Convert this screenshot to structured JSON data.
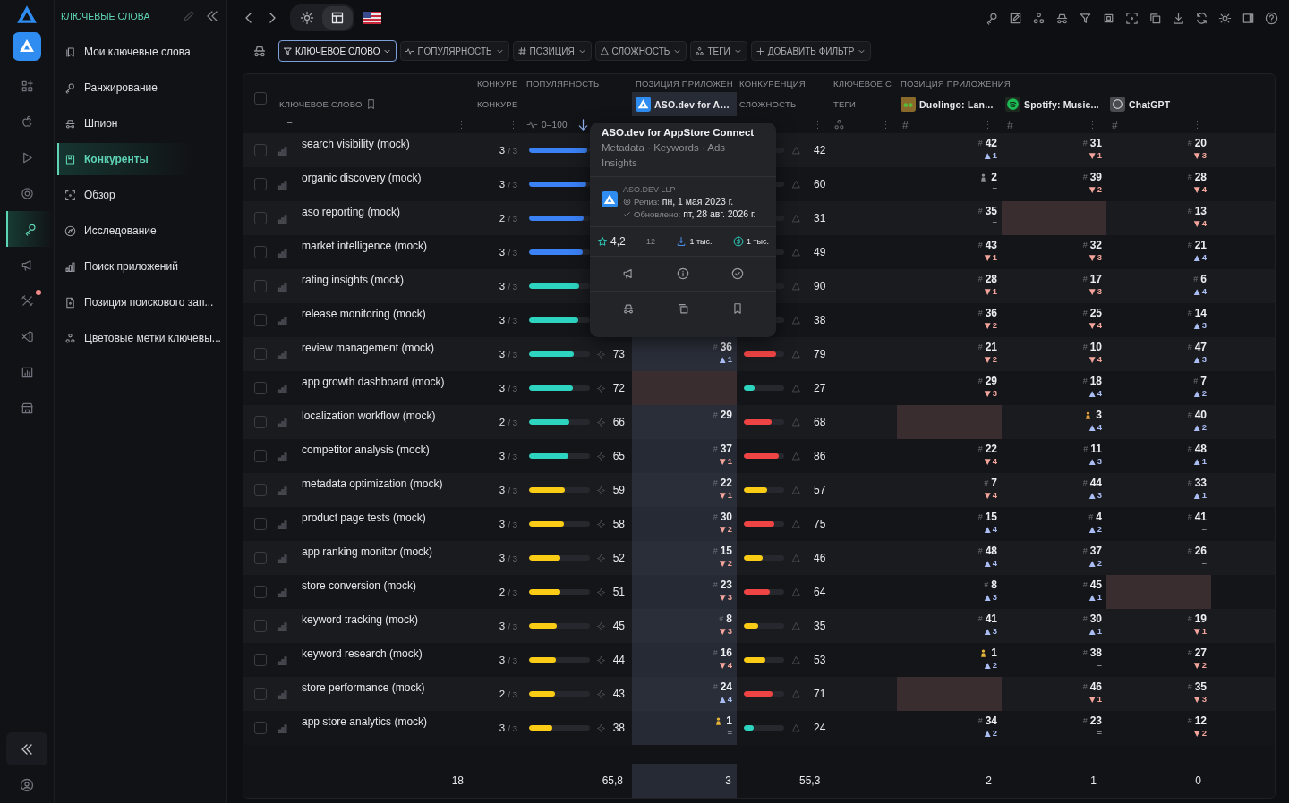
{
  "rail": [
    {
      "selected": false,
      "badge": false
    },
    {
      "selected": false,
      "badge": false
    },
    {
      "selected": false,
      "badge": false
    },
    {
      "selected": false,
      "badge": false
    },
    {
      "selected": true,
      "badge": false
    },
    {
      "selected": false,
      "badge": false
    },
    {
      "selected": false,
      "badge": true
    },
    {
      "selected": false,
      "badge": false
    },
    {
      "selected": false,
      "badge": false
    },
    {
      "selected": false,
      "badge": false
    }
  ],
  "sidebar": {
    "title": "КЛЮЧЕВЫЕ СЛОВА",
    "items": [
      {
        "label": "Мои ключевые слова",
        "selected": false
      },
      {
        "label": "Ранжирование",
        "selected": false
      },
      {
        "label": "Шпион",
        "selected": false
      },
      {
        "label": "Конкуренты",
        "selected": true
      },
      {
        "label": "Обзор",
        "selected": false
      },
      {
        "label": "Исследование",
        "selected": false
      },
      {
        "label": "Поиск приложений",
        "selected": false
      },
      {
        "label": "Позиция поискового зап...",
        "selected": false
      },
      {
        "label": "Цветовые метки ключевы...",
        "selected": false
      }
    ]
  },
  "view_modes": [
    {
      "selected": false
    },
    {
      "selected": true
    }
  ],
  "filters": [
    {
      "label": "КЛЮЧЕВОЕ СЛОВО",
      "selected": true
    },
    {
      "label": "ПОПУЛЯРНОСТЬ",
      "selected": false
    },
    {
      "label": "ПОЗИЦИЯ",
      "selected": false
    },
    {
      "label": "СЛОЖНОСТЬ",
      "selected": false
    },
    {
      "label": "ТЕГИ",
      "selected": false
    },
    {
      "label": "ДОБАВИТЬ ФИЛЬТР",
      "selected": false
    }
  ],
  "table": {
    "select_all": {
      "checked": false
    },
    "headers": {
      "keyword_title": "КЛЮЧЕВОЕ СЛОВО",
      "keyword_sub": "–",
      "competitors_title": "КОНКУРЕ",
      "competitors_sub": "КОНКУРЕ",
      "popularity_title": "ПОПУЛЯРНОСТЬ",
      "popularity_range": "0–100",
      "own_title": "ПОЗИЦИЯ ПРИЛОЖЕН",
      "own_app": "ASO.dev for A…",
      "competition_title": "КОНКУРЕНЦИЯ",
      "difficulty_sub": "СЛОЖНОСТЬ",
      "tags_title": "КЛЮЧЕВОЕ С",
      "tags_sub": "ТЕГИ",
      "apps_title": "ПОЗИЦИЯ ПРИЛОЖЕНИЯ",
      "apps": [
        {
          "name": "Duolingo: Lan...",
          "mark": "#"
        },
        {
          "name": "Spotify: Music...",
          "mark": "#"
        },
        {
          "name": "ChatGPT",
          "mark": "#"
        }
      ]
    },
    "rows": [
      {
        "keyword": "search visibility (mock)",
        "checked": false,
        "count": "3",
        "total": "/ 3",
        "popularity": {
          "level": 0.95,
          "color": "#3b82f6"
        },
        "difficulty": {
          "value": "42"
        },
        "apps": [
          {
            "kind": "rank",
            "mark": "#",
            "rank": "42",
            "arrow": "▲",
            "change": "1",
            "color": "#a9bdf3"
          },
          {
            "kind": "rank",
            "mark": "#",
            "rank": "31",
            "arrow": "▼",
            "change": "1",
            "color": "#f3a59c"
          },
          {
            "kind": "rank",
            "mark": "#",
            "rank": "20",
            "arrow": "▼",
            "change": "3",
            "color": "#f3a59c"
          }
        ]
      },
      {
        "keyword": "organic discovery (mock)",
        "checked": false,
        "count": "3",
        "total": "/ 3",
        "popularity": {
          "level": 0.94,
          "color": "#3b82f6"
        },
        "difficulty": {
          "value": "60"
        },
        "apps": [
          {
            "kind": "rank",
            "medal": {
              "color": "#8b8d93"
            },
            "rank": "2",
            "change": "=",
            "color": "#80828a"
          },
          {
            "kind": "rank",
            "mark": "#",
            "rank": "39",
            "arrow": "▼",
            "change": "2",
            "color": "#f3a59c"
          },
          {
            "kind": "rank",
            "mark": "#",
            "rank": "28",
            "arrow": "▼",
            "change": "4",
            "color": "#f3a59c"
          }
        ]
      },
      {
        "keyword": "aso reporting (mock)",
        "checked": false,
        "count": "2",
        "total": "/ 3",
        "popularity": {
          "level": 0.9,
          "color": "#3b82f6"
        },
        "difficulty": {
          "value": "31"
        },
        "apps": [
          {
            "kind": "rank",
            "mark": "#",
            "rank": "35",
            "change": "=",
            "color": "#80828a"
          },
          {
            "kind": "empty"
          },
          {
            "kind": "rank",
            "mark": "#",
            "rank": "13",
            "arrow": "▼",
            "change": "4",
            "color": "#f3a59c"
          }
        ]
      },
      {
        "keyword": "market intelligence (mock)",
        "checked": false,
        "count": "3",
        "total": "/ 3",
        "popularity": {
          "level": 0.88,
          "color": "#3b82f6"
        },
        "difficulty": {
          "value": "49"
        },
        "apps": [
          {
            "kind": "rank",
            "mark": "#",
            "rank": "43",
            "arrow": "▼",
            "change": "1",
            "color": "#f3a59c"
          },
          {
            "kind": "rank",
            "mark": "#",
            "rank": "32",
            "arrow": "▼",
            "change": "3",
            "color": "#f3a59c"
          },
          {
            "kind": "rank",
            "mark": "#",
            "rank": "21",
            "arrow": "▲",
            "change": "4",
            "color": "#a9bdf3"
          }
        ]
      },
      {
        "keyword": "rating insights (mock)",
        "checked": false,
        "count": "3",
        "total": "/ 3",
        "popularity": {
          "level": 0.82,
          "color": "#2dd4bf"
        },
        "difficulty": {
          "value": "90"
        },
        "apps": [
          {
            "kind": "rank",
            "mark": "#",
            "rank": "28",
            "arrow": "▼",
            "change": "1",
            "color": "#f3a59c"
          },
          {
            "kind": "rank",
            "mark": "#",
            "rank": "17",
            "arrow": "▼",
            "change": "3",
            "color": "#f3a59c"
          },
          {
            "kind": "rank",
            "mark": "#",
            "rank": "6",
            "arrow": "▲",
            "change": "4",
            "color": "#a9bdf3"
          }
        ]
      },
      {
        "keyword": "release monitoring (mock)",
        "checked": false,
        "count": "3",
        "total": "/ 3",
        "popularity": {
          "level": 0.81,
          "color": "#2dd4bf"
        },
        "difficulty": {
          "value": "38"
        },
        "apps": [
          {
            "kind": "rank",
            "mark": "#",
            "rank": "36",
            "arrow": "▼",
            "change": "2",
            "color": "#f3a59c"
          },
          {
            "kind": "rank",
            "mark": "#",
            "rank": "25",
            "arrow": "▼",
            "change": "4",
            "color": "#f3a59c"
          },
          {
            "kind": "rank",
            "mark": "#",
            "rank": "14",
            "arrow": "▲",
            "change": "3",
            "color": "#a9bdf3"
          }
        ]
      },
      {
        "keyword": "review management (mock)",
        "checked": false,
        "count": "3",
        "total": "/ 3",
        "popularity": {
          "level": 0.73,
          "color": "#2dd4bf",
          "value": "73"
        },
        "own": {
          "kind": "rank",
          "mark": "#",
          "rank": "36",
          "arrow": "▲",
          "change": "1",
          "color": "#a9bdf3"
        },
        "difficulty": {
          "value": "79",
          "level": 0.79,
          "color": "#ef4444"
        },
        "apps": [
          {
            "kind": "rank",
            "mark": "#",
            "rank": "21",
            "arrow": "▼",
            "change": "2",
            "color": "#f3a59c"
          },
          {
            "kind": "rank",
            "mark": "#",
            "rank": "10",
            "arrow": "▼",
            "change": "4",
            "color": "#f3a59c"
          },
          {
            "kind": "rank",
            "mark": "#",
            "rank": "47",
            "arrow": "▲",
            "change": "3",
            "color": "#a9bdf3"
          }
        ]
      },
      {
        "keyword": "app growth dashboard (mock)",
        "checked": false,
        "count": "3",
        "total": "/ 3",
        "popularity": {
          "level": 0.72,
          "color": "#2dd4bf",
          "value": "72"
        },
        "own": {
          "kind": "empty"
        },
        "difficulty": {
          "value": "27",
          "level": 0.27,
          "color": "#2dd4bf"
        },
        "apps": [
          {
            "kind": "rank",
            "mark": "#",
            "rank": "29",
            "arrow": "▼",
            "change": "3",
            "color": "#f3a59c"
          },
          {
            "kind": "rank",
            "mark": "#",
            "rank": "18",
            "arrow": "▲",
            "change": "4",
            "color": "#a9bdf3"
          },
          {
            "kind": "rank",
            "mark": "#",
            "rank": "7",
            "arrow": "▲",
            "change": "2",
            "color": "#a9bdf3"
          }
        ]
      },
      {
        "keyword": "localization workflow (mock)",
        "checked": false,
        "count": "2",
        "total": "/ 3",
        "popularity": {
          "level": 0.66,
          "color": "#2dd4bf",
          "value": "66"
        },
        "own": {
          "kind": "rank",
          "mark": "#",
          "rank": "29"
        },
        "difficulty": {
          "value": "68",
          "level": 0.68,
          "color": "#ef4444"
        },
        "apps": [
          {
            "kind": "empty"
          },
          {
            "kind": "rank",
            "medal": {
              "color": "#e5a13a"
            },
            "rank": "3",
            "arrow": "▲",
            "change": "4",
            "color": "#a9bdf3"
          },
          {
            "kind": "rank",
            "mark": "#",
            "rank": "40",
            "arrow": "▲",
            "change": "2",
            "color": "#a9bdf3"
          }
        ]
      },
      {
        "keyword": "competitor analysis (mock)",
        "checked": false,
        "count": "3",
        "total": "/ 3",
        "popularity": {
          "level": 0.65,
          "color": "#2dd4bf",
          "value": "65"
        },
        "own": {
          "kind": "rank",
          "mark": "#",
          "rank": "37",
          "arrow": "▼",
          "change": "1",
          "color": "#f3a59c"
        },
        "difficulty": {
          "value": "86",
          "level": 0.86,
          "color": "#ef4444"
        },
        "apps": [
          {
            "kind": "rank",
            "mark": "#",
            "rank": "22",
            "arrow": "▼",
            "change": "4",
            "color": "#f3a59c"
          },
          {
            "kind": "rank",
            "mark": "#",
            "rank": "11",
            "arrow": "▲",
            "change": "3",
            "color": "#a9bdf3"
          },
          {
            "kind": "rank",
            "mark": "#",
            "rank": "48",
            "arrow": "▲",
            "change": "1",
            "color": "#a9bdf3"
          }
        ]
      },
      {
        "keyword": "metadata optimization (mock)",
        "checked": false,
        "count": "3",
        "total": "/ 3",
        "popularity": {
          "level": 0.59,
          "color": "#facc15",
          "value": "59"
        },
        "own": {
          "kind": "rank",
          "mark": "#",
          "rank": "22",
          "arrow": "▼",
          "change": "1",
          "color": "#f3a59c"
        },
        "difficulty": {
          "value": "57",
          "level": 0.57,
          "color": "#facc15"
        },
        "apps": [
          {
            "kind": "rank",
            "mark": "#",
            "rank": "7",
            "arrow": "▼",
            "change": "4",
            "color": "#f3a59c"
          },
          {
            "kind": "rank",
            "mark": "#",
            "rank": "44",
            "arrow": "▲",
            "change": "3",
            "color": "#a9bdf3"
          },
          {
            "kind": "rank",
            "mark": "#",
            "rank": "33",
            "arrow": "▲",
            "change": "1",
            "color": "#a9bdf3"
          }
        ]
      },
      {
        "keyword": "product page tests (mock)",
        "checked": false,
        "count": "3",
        "total": "/ 3",
        "popularity": {
          "level": 0.58,
          "color": "#facc15",
          "value": "58"
        },
        "own": {
          "kind": "rank",
          "mark": "#",
          "rank": "30",
          "arrow": "▼",
          "change": "2",
          "color": "#f3a59c"
        },
        "difficulty": {
          "value": "75",
          "level": 0.75,
          "color": "#ef4444"
        },
        "apps": [
          {
            "kind": "rank",
            "mark": "#",
            "rank": "15",
            "arrow": "▲",
            "change": "4",
            "color": "#a9bdf3"
          },
          {
            "kind": "rank",
            "mark": "#",
            "rank": "4",
            "arrow": "▲",
            "change": "2",
            "color": "#a9bdf3"
          },
          {
            "kind": "rank",
            "mark": "#",
            "rank": "41",
            "change": "=",
            "color": "#80828a"
          }
        ]
      },
      {
        "keyword": "app ranking monitor (mock)",
        "checked": false,
        "count": "3",
        "total": "/ 3",
        "popularity": {
          "level": 0.52,
          "color": "#facc15",
          "value": "52"
        },
        "own": {
          "kind": "rank",
          "mark": "#",
          "rank": "15",
          "arrow": "▼",
          "change": "2",
          "color": "#f3a59c"
        },
        "difficulty": {
          "value": "46",
          "level": 0.46,
          "color": "#facc15"
        },
        "apps": [
          {
            "kind": "rank",
            "mark": "#",
            "rank": "48",
            "arrow": "▲",
            "change": "4",
            "color": "#a9bdf3"
          },
          {
            "kind": "rank",
            "mark": "#",
            "rank": "37",
            "arrow": "▲",
            "change": "2",
            "color": "#a9bdf3"
          },
          {
            "kind": "rank",
            "mark": "#",
            "rank": "26",
            "change": "=",
            "color": "#80828a"
          }
        ]
      },
      {
        "keyword": "store conversion (mock)",
        "checked": false,
        "count": "2",
        "total": "/ 3",
        "popularity": {
          "level": 0.51,
          "color": "#facc15",
          "value": "51"
        },
        "own": {
          "kind": "rank",
          "mark": "#",
          "rank": "23",
          "arrow": "▼",
          "change": "3",
          "color": "#f3a59c"
        },
        "difficulty": {
          "value": "64",
          "level": 0.64,
          "color": "#ef4444"
        },
        "apps": [
          {
            "kind": "rank",
            "mark": "#",
            "rank": "8",
            "arrow": "▲",
            "change": "3",
            "color": "#a9bdf3"
          },
          {
            "kind": "rank",
            "mark": "#",
            "rank": "45",
            "arrow": "▲",
            "change": "1",
            "color": "#a9bdf3"
          },
          {
            "kind": "empty"
          }
        ]
      },
      {
        "keyword": "keyword tracking (mock)",
        "checked": false,
        "count": "3",
        "total": "/ 3",
        "popularity": {
          "level": 0.45,
          "color": "#facc15",
          "value": "45"
        },
        "own": {
          "kind": "rank",
          "mark": "#",
          "rank": "8",
          "arrow": "▼",
          "change": "3",
          "color": "#f3a59c"
        },
        "difficulty": {
          "value": "35",
          "level": 0.35,
          "color": "#facc15"
        },
        "apps": [
          {
            "kind": "rank",
            "mark": "#",
            "rank": "41",
            "arrow": "▲",
            "change": "3",
            "color": "#a9bdf3"
          },
          {
            "kind": "rank",
            "mark": "#",
            "rank": "30",
            "arrow": "▲",
            "change": "1",
            "color": "#a9bdf3"
          },
          {
            "kind": "rank",
            "mark": "#",
            "rank": "19",
            "arrow": "▼",
            "change": "1",
            "color": "#f3a59c"
          }
        ]
      },
      {
        "keyword": "keyword research (mock)",
        "checked": false,
        "count": "3",
        "total": "/ 3",
        "popularity": {
          "level": 0.44,
          "color": "#facc15",
          "value": "44"
        },
        "own": {
          "kind": "rank",
          "mark": "#",
          "rank": "16",
          "arrow": "▼",
          "change": "4",
          "color": "#f3a59c"
        },
        "difficulty": {
          "value": "53",
          "level": 0.53,
          "color": "#facc15"
        },
        "apps": [
          {
            "kind": "rank",
            "medal": {
              "color": "#e5b53a"
            },
            "rank": "1",
            "arrow": "▲",
            "change": "2",
            "color": "#a9bdf3"
          },
          {
            "kind": "rank",
            "mark": "#",
            "rank": "38",
            "change": "=",
            "color": "#80828a"
          },
          {
            "kind": "rank",
            "mark": "#",
            "rank": "27",
            "arrow": "▼",
            "change": "2",
            "color": "#f3a59c"
          }
        ]
      },
      {
        "keyword": "store performance (mock)",
        "checked": false,
        "count": "2",
        "total": "/ 3",
        "popularity": {
          "level": 0.43,
          "color": "#facc15",
          "value": "43"
        },
        "own": {
          "kind": "rank",
          "mark": "#",
          "rank": "24",
          "arrow": "▲",
          "change": "4",
          "color": "#a9bdf3"
        },
        "difficulty": {
          "value": "71",
          "level": 0.71,
          "color": "#ef4444"
        },
        "apps": [
          {
            "kind": "empty"
          },
          {
            "kind": "rank",
            "mark": "#",
            "rank": "46",
            "arrow": "▼",
            "change": "1",
            "color": "#f3a59c"
          },
          {
            "kind": "rank",
            "mark": "#",
            "rank": "35",
            "arrow": "▼",
            "change": "3",
            "color": "#f3a59c"
          }
        ]
      },
      {
        "keyword": "app store analytics (mock)",
        "checked": false,
        "count": "3",
        "total": "/ 3",
        "popularity": {
          "level": 0.38,
          "color": "#facc15",
          "value": "38"
        },
        "own": {
          "kind": "rank",
          "medal": {
            "color": "#e5b53a"
          },
          "rank": "1",
          "change": "=",
          "color": "#80828a"
        },
        "difficulty": {
          "value": "24",
          "level": 0.24,
          "color": "#2dd4bf"
        },
        "apps": [
          {
            "kind": "rank",
            "mark": "#",
            "rank": "34",
            "arrow": "▲",
            "change": "2",
            "color": "#a9bdf3"
          },
          {
            "kind": "rank",
            "mark": "#",
            "rank": "23",
            "change": "=",
            "color": "#80828a"
          },
          {
            "kind": "rank",
            "mark": "#",
            "rank": "12",
            "arrow": "▼",
            "change": "2",
            "color": "#f3a59c"
          }
        ]
      }
    ],
    "totals": {
      "keywords": "18",
      "popularity": "65,8",
      "own": "3",
      "difficulty": "55,3",
      "apps": [
        "2",
        "1",
        "0"
      ]
    }
  },
  "popover": {
    "title": "ASO.dev for AppStore Connect",
    "subtitle": "Metadata · Keywords · Ads Insights",
    "developer": "ASO.DEV LLP",
    "release_label": "Релиз:",
    "release_date": "пн, 1 мая 2023 г.",
    "updated_label": "Обновлено:",
    "updated_date": "пт, 28 авг. 2026 г.",
    "rating": "4,2",
    "reviews": "12",
    "downloads": "1 тыс.",
    "revenue": "1 тыс."
  }
}
